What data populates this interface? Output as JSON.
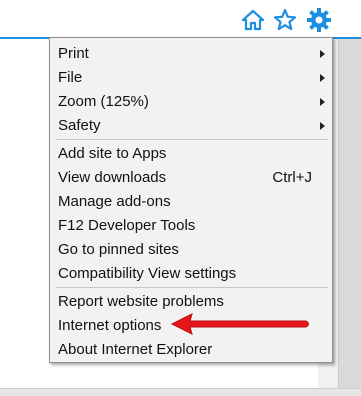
{
  "toolbar": {
    "icons": [
      "home-icon",
      "favorites-star-icon",
      "tools-gear-icon"
    ],
    "accent_color": "#1e8fe0"
  },
  "menu": {
    "items": [
      {
        "label": "Print",
        "submenu": true
      },
      {
        "label": "File",
        "submenu": true
      },
      {
        "label": "Zoom (125%)",
        "submenu": true
      },
      {
        "label": "Safety",
        "submenu": true
      },
      {
        "label": "Add site to Apps"
      },
      {
        "label": "View downloads",
        "shortcut": "Ctrl+J"
      },
      {
        "label": "Manage add-ons"
      },
      {
        "label": "F12 Developer Tools"
      },
      {
        "label": "Go to pinned sites"
      },
      {
        "label": "Compatibility View settings"
      },
      {
        "label": "Report website problems"
      },
      {
        "label": "Internet options"
      },
      {
        "label": "About Internet Explorer"
      }
    ]
  },
  "annotation": {
    "arrow_color": "#e8151b",
    "points_to": "Internet options"
  }
}
